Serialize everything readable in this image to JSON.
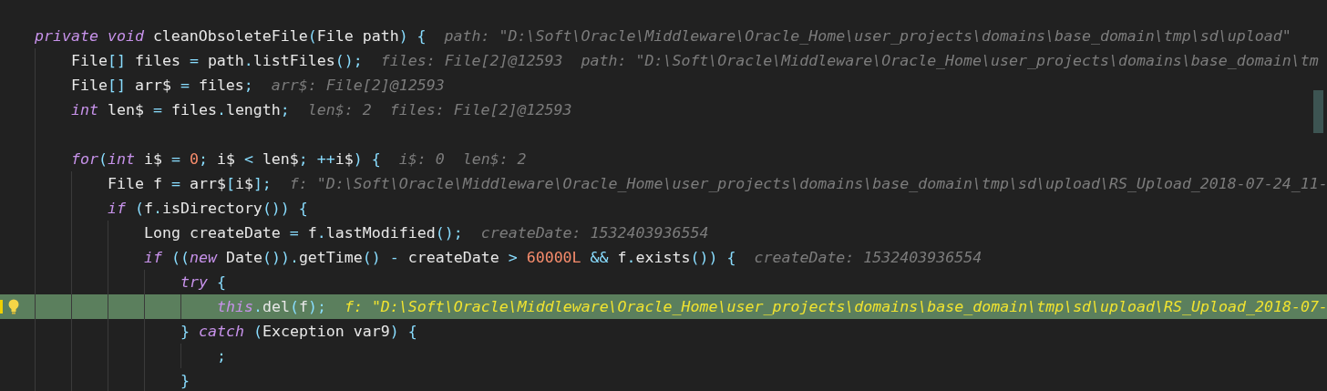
{
  "editor": {
    "lines": [
      {
        "highlighted": false,
        "code": [
          {
            "kind": "kw",
            "text": "private void"
          },
          {
            "kind": "id",
            "text": " cleanObsoleteFile"
          },
          {
            "kind": "op",
            "text": "("
          },
          {
            "kind": "id",
            "text": "File path"
          },
          {
            "kind": "op",
            "text": ") {"
          }
        ],
        "hints": [
          "path: \"D:\\Soft\\Oracle\\Middleware\\Oracle_Home\\user_projects\\domains\\base_domain\\tmp\\sd\\upload\""
        ],
        "children": [
          {
            "highlighted": false,
            "code": [
              {
                "kind": "id",
                "text": "File"
              },
              {
                "kind": "op",
                "text": "[]"
              },
              {
                "kind": "id",
                "text": " files "
              },
              {
                "kind": "op",
                "text": "="
              },
              {
                "kind": "id",
                "text": " path"
              },
              {
                "kind": "op",
                "text": "."
              },
              {
                "kind": "id",
                "text": "listFiles"
              },
              {
                "kind": "op",
                "text": "();"
              }
            ],
            "hints": [
              "files: File[2]@12593",
              "path: \"D:\\Soft\\Oracle\\Middleware\\Oracle_Home\\user_projects\\domains\\base_domain\\tm"
            ]
          },
          {
            "highlighted": false,
            "code": [
              {
                "kind": "id",
                "text": "File"
              },
              {
                "kind": "op",
                "text": "[]"
              },
              {
                "kind": "id",
                "text": " arr$ "
              },
              {
                "kind": "op",
                "text": "="
              },
              {
                "kind": "id",
                "text": " files"
              },
              {
                "kind": "op",
                "text": ";"
              }
            ],
            "hints": [
              "arr$: File[2]@12593"
            ]
          },
          {
            "highlighted": false,
            "code": [
              {
                "kind": "kw",
                "text": "int"
              },
              {
                "kind": "id",
                "text": " len$ "
              },
              {
                "kind": "op",
                "text": "="
              },
              {
                "kind": "id",
                "text": " files"
              },
              {
                "kind": "op",
                "text": "."
              },
              {
                "kind": "id",
                "text": "length"
              },
              {
                "kind": "op",
                "text": ";"
              }
            ],
            "hints": [
              "len$: 2",
              "files: File[2]@12593"
            ]
          },
          {
            "highlighted": false,
            "blank_line_before": true,
            "code": [
              {
                "kind": "kw",
                "text": "for"
              },
              {
                "kind": "op",
                "text": "("
              },
              {
                "kind": "kw",
                "text": "int"
              },
              {
                "kind": "id",
                "text": " i$ "
              },
              {
                "kind": "op",
                "text": "= "
              },
              {
                "kind": "num",
                "text": "0"
              },
              {
                "kind": "op",
                "text": ";"
              },
              {
                "kind": "id",
                "text": " i$ "
              },
              {
                "kind": "op",
                "text": "<"
              },
              {
                "kind": "id",
                "text": " len$"
              },
              {
                "kind": "op",
                "text": "; ++"
              },
              {
                "kind": "id",
                "text": "i$"
              },
              {
                "kind": "op",
                "text": ") {"
              }
            ],
            "hints": [
              "i$: 0",
              "len$: 2"
            ],
            "children": [
              {
                "highlighted": false,
                "code": [
                  {
                    "kind": "id",
                    "text": "File f "
                  },
                  {
                    "kind": "op",
                    "text": "="
                  },
                  {
                    "kind": "id",
                    "text": " arr$"
                  },
                  {
                    "kind": "op",
                    "text": "["
                  },
                  {
                    "kind": "id",
                    "text": "i$"
                  },
                  {
                    "kind": "op",
                    "text": "];"
                  }
                ],
                "hints": [
                  "f: \"D:\\Soft\\Oracle\\Middleware\\Oracle_Home\\user_projects\\domains\\base_domain\\tmp\\sd\\upload\\RS_Upload_2018-07-24_11-"
                ]
              },
              {
                "highlighted": false,
                "code": [
                  {
                    "kind": "kw",
                    "text": "if"
                  },
                  {
                    "kind": "op",
                    "text": " ("
                  },
                  {
                    "kind": "id",
                    "text": "f"
                  },
                  {
                    "kind": "op",
                    "text": "."
                  },
                  {
                    "kind": "id",
                    "text": "isDirectory"
                  },
                  {
                    "kind": "op",
                    "text": "()) {"
                  }
                ],
                "children": [
                  {
                    "highlighted": false,
                    "code": [
                      {
                        "kind": "id",
                        "text": "Long createDate "
                      },
                      {
                        "kind": "op",
                        "text": "="
                      },
                      {
                        "kind": "id",
                        "text": " f"
                      },
                      {
                        "kind": "op",
                        "text": "."
                      },
                      {
                        "kind": "id",
                        "text": "lastModified"
                      },
                      {
                        "kind": "op",
                        "text": "();"
                      }
                    ],
                    "hints": [
                      "createDate: 1532403936554"
                    ]
                  },
                  {
                    "highlighted": false,
                    "code": [
                      {
                        "kind": "kw",
                        "text": "if"
                      },
                      {
                        "kind": "op",
                        "text": " (("
                      },
                      {
                        "kind": "kw",
                        "text": "new"
                      },
                      {
                        "kind": "id",
                        "text": " Date"
                      },
                      {
                        "kind": "op",
                        "text": "())."
                      },
                      {
                        "kind": "id",
                        "text": "getTime"
                      },
                      {
                        "kind": "op",
                        "text": "() - "
                      },
                      {
                        "kind": "id",
                        "text": "createDate "
                      },
                      {
                        "kind": "op",
                        "text": "> "
                      },
                      {
                        "kind": "num",
                        "text": "60000L"
                      },
                      {
                        "kind": "op",
                        "text": " && "
                      },
                      {
                        "kind": "id",
                        "text": "f"
                      },
                      {
                        "kind": "op",
                        "text": "."
                      },
                      {
                        "kind": "id",
                        "text": "exists"
                      },
                      {
                        "kind": "op",
                        "text": "()) {"
                      }
                    ],
                    "hints": [
                      "createDate: 1532403936554"
                    ],
                    "children": [
                      {
                        "highlighted": false,
                        "code": [
                          {
                            "kind": "kw",
                            "text": "try"
                          },
                          {
                            "kind": "op",
                            "text": " {"
                          }
                        ],
                        "children": [
                          {
                            "highlighted": true,
                            "code": [
                              {
                                "kind": "kw",
                                "text": "this"
                              },
                              {
                                "kind": "op",
                                "text": "."
                              },
                              {
                                "kind": "id",
                                "text": "del"
                              },
                              {
                                "kind": "op",
                                "text": "("
                              },
                              {
                                "kind": "id",
                                "text": "f"
                              },
                              {
                                "kind": "op",
                                "text": ");"
                              }
                            ],
                            "hints": [
                              "f: \"D:\\Soft\\Oracle\\Middleware\\Oracle_Home\\user_projects\\domains\\base_domain\\tmp\\sd\\upload\\RS_Upload_2018-07-"
                            ]
                          }
                        ]
                      },
                      {
                        "highlighted": false,
                        "code": [
                          {
                            "kind": "op",
                            "text": "} "
                          },
                          {
                            "kind": "kw",
                            "text": "catch"
                          },
                          {
                            "kind": "op",
                            "text": " ("
                          },
                          {
                            "kind": "id",
                            "text": "Exception var9"
                          },
                          {
                            "kind": "op",
                            "text": ") {"
                          }
                        ],
                        "children": [
                          {
                            "highlighted": false,
                            "code": [
                              {
                                "kind": "op",
                                "text": ";"
                              }
                            ]
                          }
                        ]
                      },
                      {
                        "highlighted": false,
                        "code": [
                          {
                            "kind": "op",
                            "text": "}"
                          }
                        ]
                      }
                    ]
                  }
                ]
              }
            ]
          }
        ]
      }
    ]
  }
}
